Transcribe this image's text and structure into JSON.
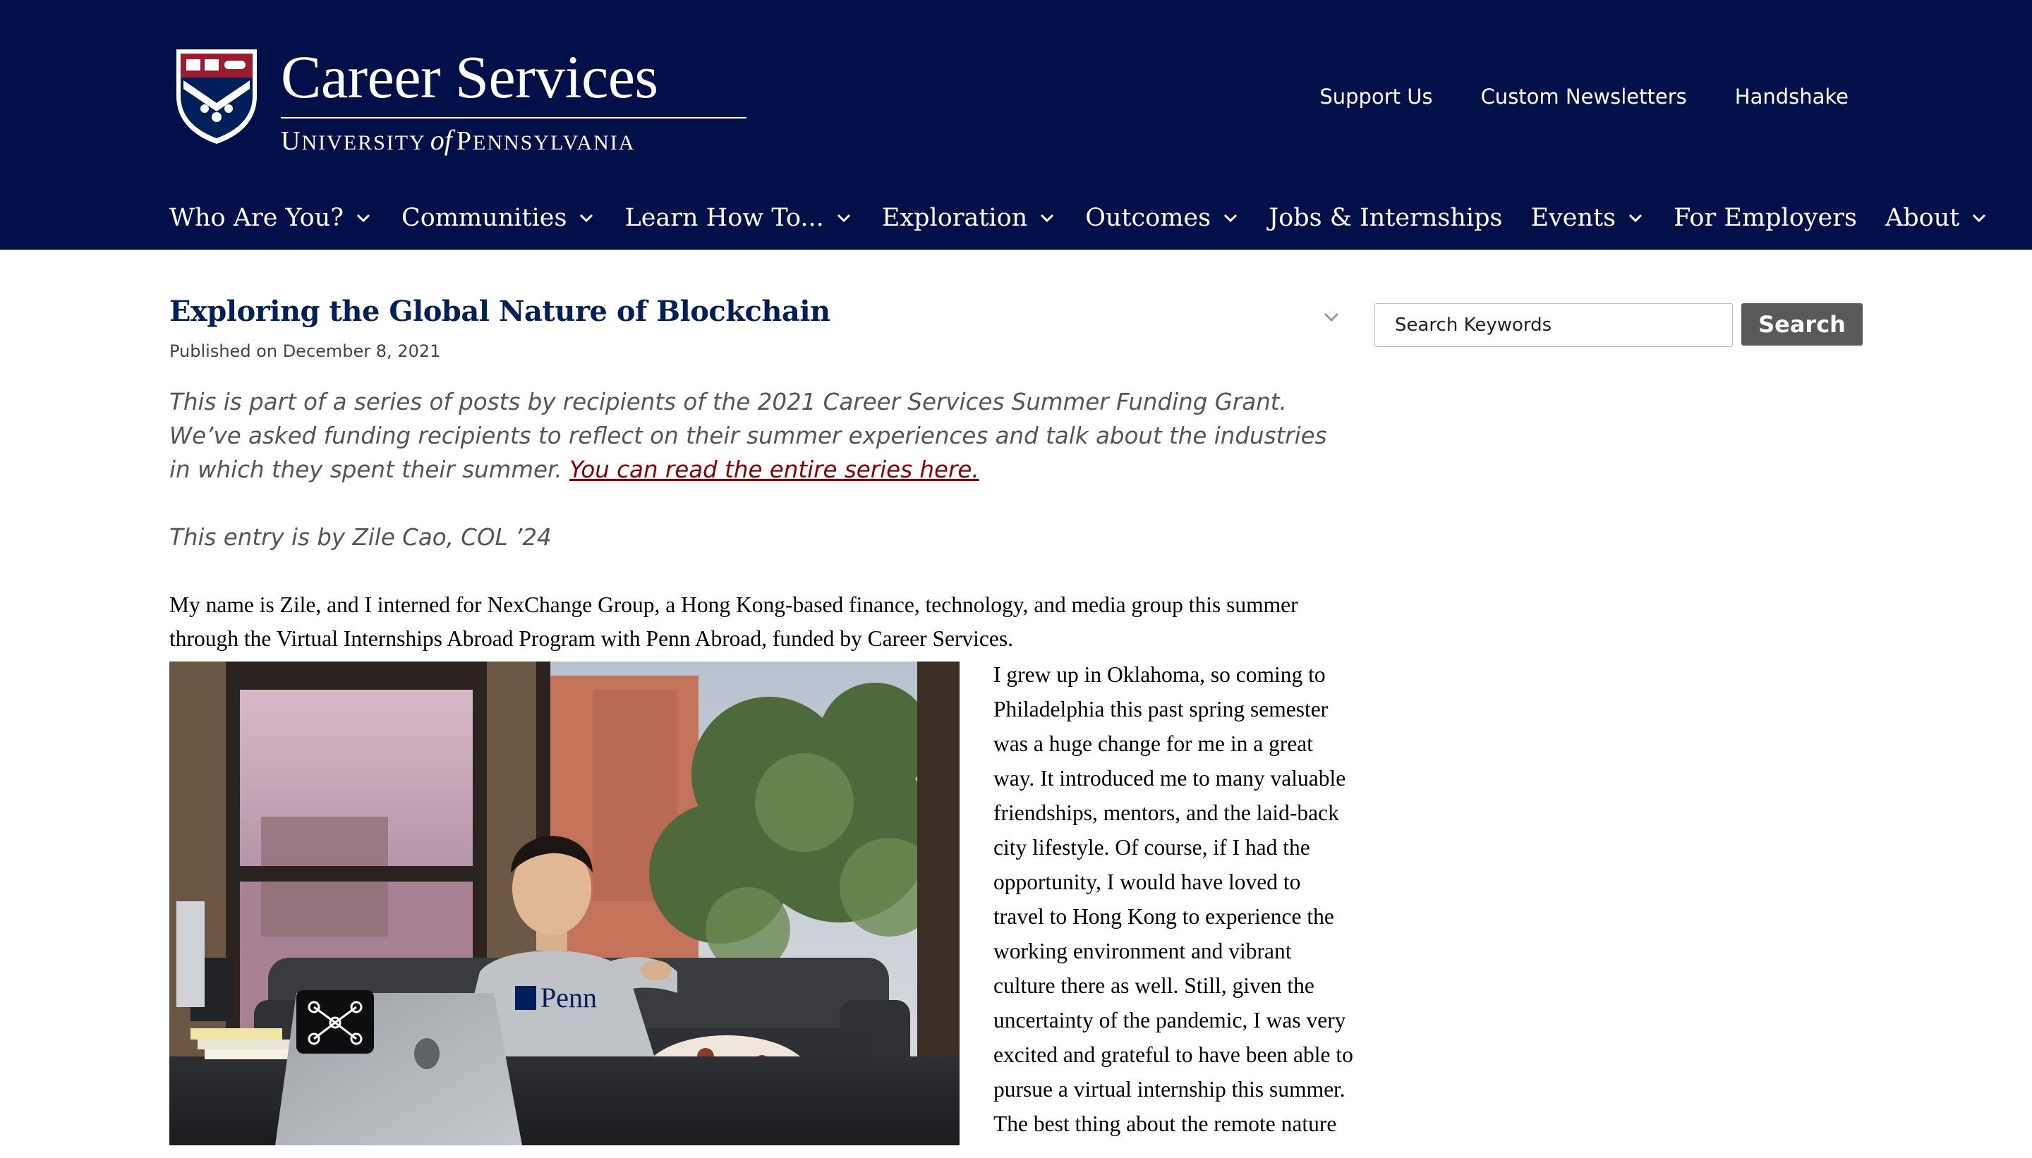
{
  "header": {
    "logo_title": "Career Services",
    "logo_subtitle_u": "U",
    "logo_subtitle_niversity": "NIVERSITY",
    "logo_subtitle_of": "of",
    "logo_subtitle_p": "P",
    "logo_subtitle_ennsylvania": "ENNSYLVANIA",
    "utility_nav": [
      "Support Us",
      "Custom Newsletters",
      "Handshake"
    ],
    "main_nav": [
      {
        "label": "Who Are You?",
        "has_dropdown": true
      },
      {
        "label": "Communities",
        "has_dropdown": true
      },
      {
        "label": "Learn How To...",
        "has_dropdown": true
      },
      {
        "label": "Exploration",
        "has_dropdown": true
      },
      {
        "label": "Outcomes",
        "has_dropdown": true
      },
      {
        "label": "Jobs & Internships",
        "has_dropdown": false
      },
      {
        "label": "Events",
        "has_dropdown": true
      },
      {
        "label": "For Employers",
        "has_dropdown": false
      },
      {
        "label": "About",
        "has_dropdown": true
      }
    ]
  },
  "article": {
    "title": "Exploring the Global Nature of Blockchain",
    "published": "Published on December 8, 2021",
    "intro_text": "This is part of a series of posts by recipients of the 2021 Career Services Summer Funding Grant. We’ve asked funding recipients to reflect on their summer experiences and talk about the industries in which they spent their summer.",
    "intro_link": "You can read the entire series here.",
    "byline": "This entry is by Zile Cao, COL ’24",
    "paragraph_1": "My name is Zile, and I interned for NexChange Group, a Hong Kong-based finance, technology, and media group this summer through the Virtual Internships Abroad Program with Penn Abroad, funded by Career Services.",
    "paragraph_2": "I grew up in Oklahoma, so coming to Philadelphia this past spring semester was a huge change for me in a great way. It introduced me to many valuable friendships, mentors, and the laid-back city lifestyle. Of course, if I had the opportunity, I would have loved to travel to Hong Kong to experience the working environment and vibrant culture there as well. Still, given the uncertainty of the pandemic, I was very excited and grateful to have been able to pursue a virtual internship this summer.",
    "paragraph_3_start": "The best thing about the remote nature",
    "photo_shirt_text": "Penn"
  },
  "sidebar": {
    "search_placeholder": "Search Keywords",
    "search_button": "Search"
  },
  "colors": {
    "header_bg": "#011049",
    "title_blue": "#011f5b",
    "link_red": "#8b0000",
    "search_button_bg": "#595959"
  }
}
